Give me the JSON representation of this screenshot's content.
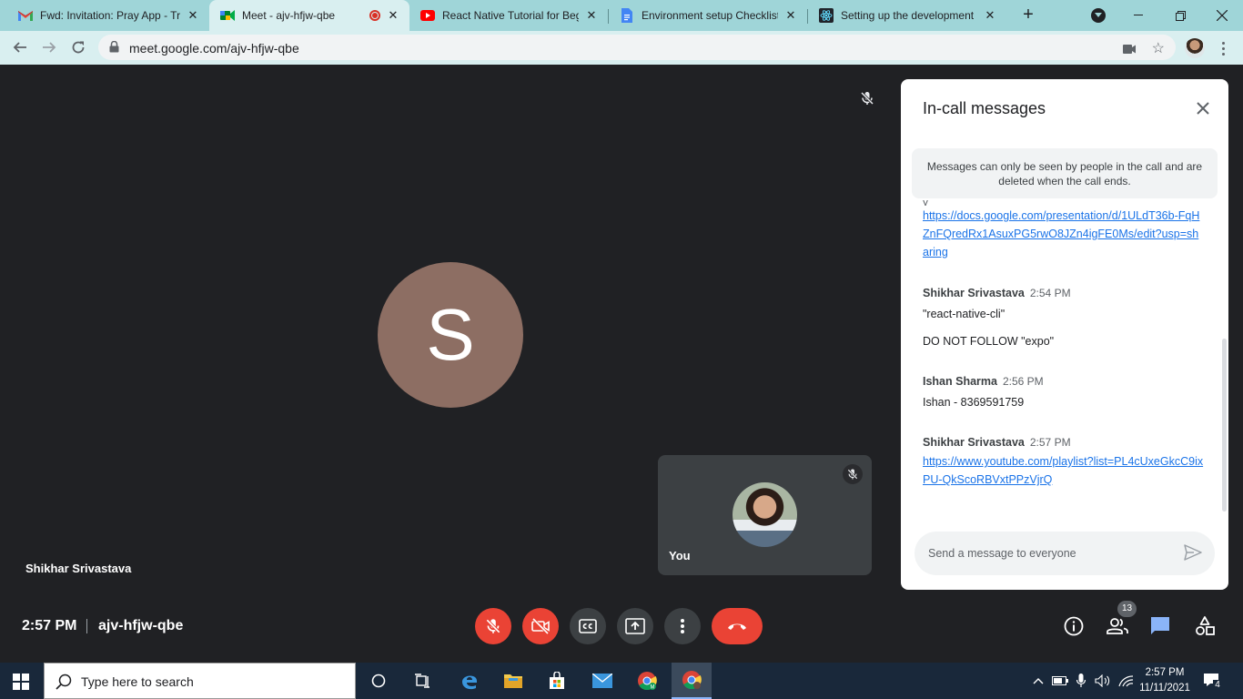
{
  "browser": {
    "tabs": [
      {
        "title": "Fwd: Invitation: Pray App - Tra",
        "icon": "gmail-icon",
        "active": false
      },
      {
        "title": "Meet - ajv-hfjw-qbe",
        "icon": "meet-icon",
        "active": true,
        "recording": true
      },
      {
        "title": "React Native Tutorial for Begi",
        "icon": "youtube-icon",
        "active": false
      },
      {
        "title": "Environment setup Checklist",
        "icon": "docs-icon",
        "active": false
      },
      {
        "title": "Setting up the development",
        "icon": "react-icon",
        "active": false
      }
    ],
    "url": "meet.google.com/ajv-hfjw-qbe"
  },
  "meet": {
    "main_participant": {
      "initial": "S",
      "name": "Shikhar Srivastava"
    },
    "self_tile": {
      "label": "You"
    },
    "chat": {
      "title": "In-call messages",
      "notice": "Messages can only be seen by people in the call and are deleted when the call ends.",
      "messages": [
        {
          "sender": "",
          "time": "",
          "link": "https://docs.google.com/presentation/d/1ULdT36b-FqHZnFQredRx1AsuxPG5rwO8JZn4igFE0Ms/edit?usp=sharing"
        },
        {
          "sender": "Shikhar Srivastava",
          "time": "2:54 PM",
          "lines": [
            "\"react-native-cli\"",
            "DO NOT FOLLOW \"expo\""
          ]
        },
        {
          "sender": "Ishan Sharma",
          "time": "2:56 PM",
          "lines": [
            "Ishan - 8369591759"
          ]
        },
        {
          "sender": "Shikhar Srivastava",
          "time": "2:57 PM",
          "link": "https://www.youtube.com/playlist?list=PL4cUxeGkcC9ixPU-QkScoRBVxtPPzVjrQ"
        }
      ],
      "compose_placeholder": "Send a message to everyone"
    },
    "footer": {
      "time": "2:57 PM",
      "meeting_code": "ajv-hfjw-qbe",
      "participant_count": "13"
    }
  },
  "taskbar": {
    "search_placeholder": "Type here to search",
    "clock_time": "2:57 PM",
    "clock_date": "11/11/2021",
    "notification_count": "4"
  }
}
